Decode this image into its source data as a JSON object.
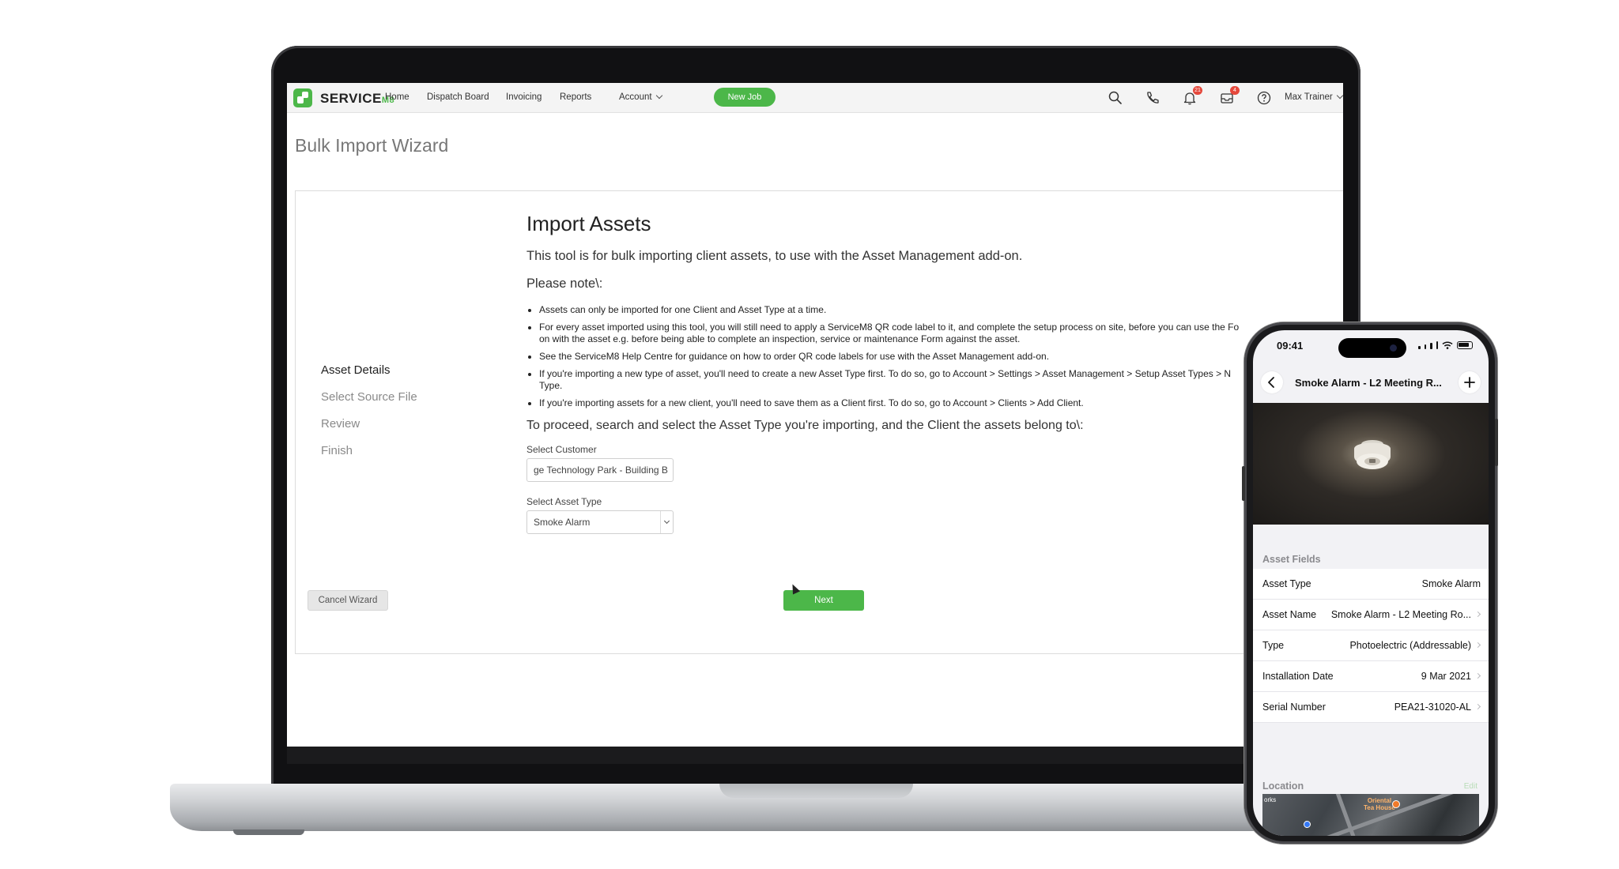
{
  "app": {
    "brand": "SERVICE",
    "brand_suffix": "M8",
    "nav": {
      "home": "Home",
      "dispatch": "Dispatch Board",
      "invoicing": "Invoicing",
      "reports": "Reports",
      "account": "Account",
      "new_job": "New Job",
      "notifications_count": "21",
      "inbox_count": "4",
      "user": "Max Trainer"
    },
    "page_title": "Bulk Import Wizard",
    "steps": [
      "Asset Details",
      "Select Source File",
      "Review",
      "Finish"
    ],
    "active_step": 0,
    "import": {
      "heading": "Import Assets",
      "lead": "This tool is for bulk importing client assets, to use with the Asset Management add-on.",
      "note_label": "Please note\\:",
      "bullets": [
        "Assets can only be imported for one Client and Asset Type at a time.",
        "For every asset imported using this tool, you will still need to apply a ServiceM8 QR code label to it, and complete the setup process on site, before you can use the Fo",
        "on with the asset e.g. before being able to complete an inspection, service or maintenance Form against the asset.",
        "See the ServiceM8 Help Centre for guidance on how to order QR code labels for use with the Asset Management add-on.",
        "If you're importing a new type of asset, you'll need to create a new Asset Type first. To do so, go to Account > Settings > Asset Management > Setup Asset Types > N",
        "Type.",
        "If you're importing assets for a new client, you'll need to save them as a Client first. To do so, go to Account > Clients > Add Client."
      ],
      "proceed": "To proceed, search and select the Asset Type you're importing, and the Client the assets belong to\\:",
      "customer_label": "Select Customer",
      "customer_value": "ge Technology Park - Building B",
      "asset_type_label": "Select Asset Type",
      "asset_type_value": "Smoke Alarm",
      "cancel": "Cancel Wizard",
      "next": "Next"
    }
  },
  "phone": {
    "time": "09:41",
    "title": "Smoke Alarm - L2 Meeting R...",
    "section_asset_fields": "Asset Fields",
    "fields": [
      {
        "label": "Asset Type",
        "value": "Smoke Alarm"
      },
      {
        "label": "Asset Name",
        "value": "Smoke Alarm - L2 Meeting Ro..."
      },
      {
        "label": "Type",
        "value": "Photoelectric (Addressable)"
      },
      {
        "label": "Installation Date",
        "value": "9 Mar 2021"
      },
      {
        "label": "Serial Number",
        "value": "PEA21-31020-AL"
      }
    ],
    "section_location": "Location",
    "location_edit": "Edit",
    "map_label_left": "orks",
    "map_place": "Oriental\nTea House"
  },
  "colors": {
    "brand_green": "#4cb749",
    "badge_red": "#e5483c",
    "laptop_bezel": "#111113",
    "phone_frame": "#1a1a1c"
  },
  "icons": [
    "search-icon",
    "phone-icon",
    "bell-icon",
    "inbox-icon",
    "help-icon",
    "chevron-down-icon",
    "back-arrow-icon",
    "plus-icon",
    "smoke-alarm-photo",
    "map-pin-icon"
  ]
}
